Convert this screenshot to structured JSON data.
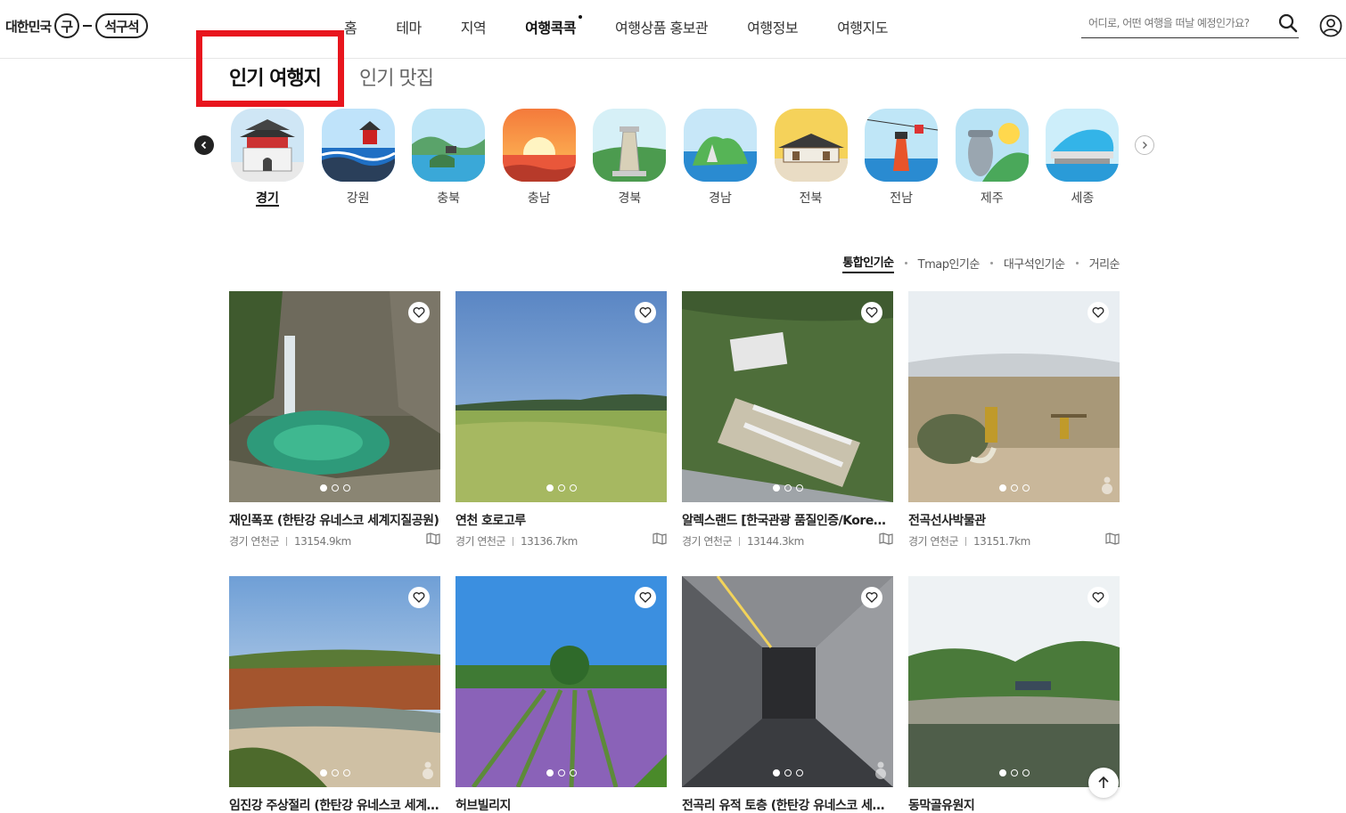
{
  "header": {
    "logo": {
      "part1": "대한민국",
      "part2": "구",
      "part3": "석구석"
    },
    "nav": [
      "홈",
      "테마",
      "지역",
      "여행콕콕",
      "여행상품 홍보관",
      "여행정보",
      "여행지도"
    ],
    "nav_active_index": 3,
    "search_placeholder": "어디로, 어떤 여행을 떠날 예정인가요?"
  },
  "section_tabs": {
    "active": "인기 여행지",
    "other": "인기 맛집"
  },
  "regions": [
    "경기",
    "강원",
    "충북",
    "충남",
    "경북",
    "경남",
    "전북",
    "전남",
    "제주",
    "세종"
  ],
  "region_active_index": 0,
  "sorts": [
    "통합인기순",
    "Tmap인기순",
    "대구석인기순",
    "거리순"
  ],
  "sort_active_index": 0,
  "cards": [
    {
      "title": "재인폭포 (한탄강 유네스코 세계지질공원)",
      "region": "경기 연천군",
      "distance": "13154.9km"
    },
    {
      "title": "연천 호로고루",
      "region": "경기 연천군",
      "distance": "13136.7km"
    },
    {
      "title": "알렉스랜드 [한국관광 품질인증/Korea Quality]",
      "region": "경기 연천군",
      "distance": "13144.3km"
    },
    {
      "title": "전곡선사박물관",
      "region": "경기 연천군",
      "distance": "13151.7km"
    },
    {
      "title": "임진강 주상절리 (한탄강 유네스코 세계지질공원)",
      "region": "",
      "distance": ""
    },
    {
      "title": "허브빌리지",
      "region": "",
      "distance": ""
    },
    {
      "title": "전곡리 유적 토층 (한탄강 유네스코 세계지질공원)",
      "region": "",
      "distance": ""
    },
    {
      "title": "동막골유원지",
      "region": "",
      "distance": ""
    }
  ],
  "icons": {
    "search": "search-icon",
    "user": "user-icon",
    "heart": "heart-icon",
    "map": "map-icon",
    "prev": "chevron-left-icon",
    "next": "chevron-right-icon",
    "top": "arrow-up-icon"
  },
  "colors": {
    "highlight": "#e8151d",
    "text": "#222222"
  }
}
